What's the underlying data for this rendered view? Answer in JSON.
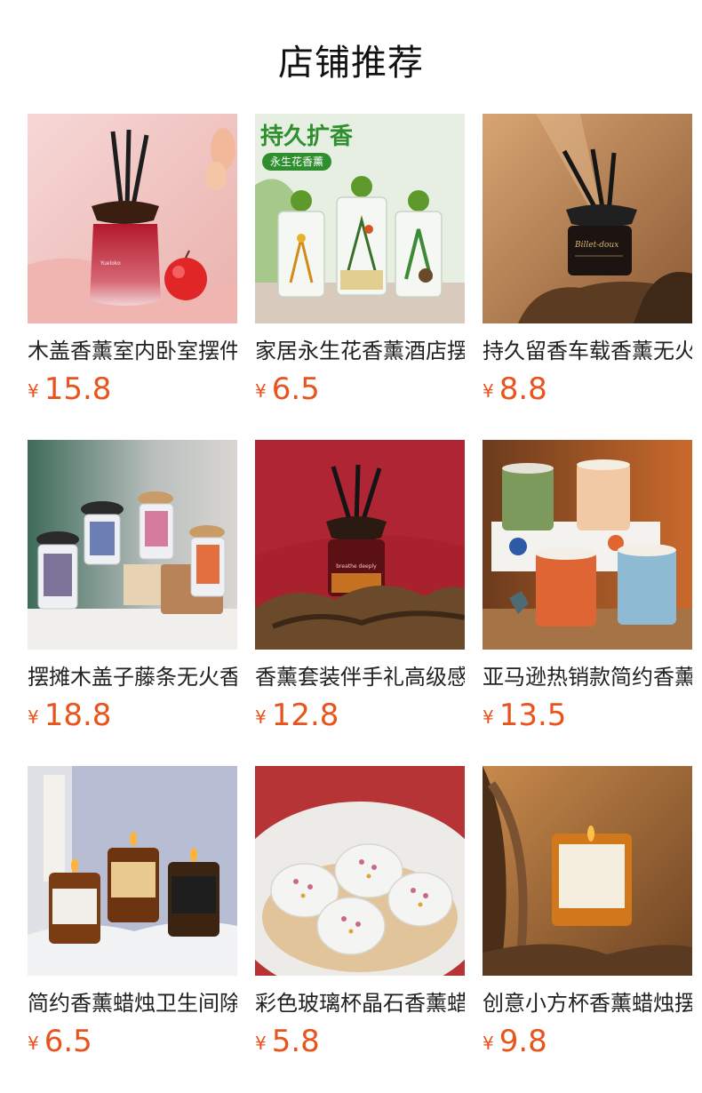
{
  "header": {
    "title": "店铺推荐"
  },
  "products": [
    {
      "name": "木盖香薰室内卧室摆件",
      "currency": "¥",
      "price": "15.8",
      "image": "red-diffuser-apple"
    },
    {
      "name": "家居永生花香薰酒店摆件",
      "currency": "¥",
      "price": "6.5",
      "image": "preserved-flower-diffusers",
      "image_text": {
        "headline": "持久扩香",
        "subline": "永生花香薰"
      }
    },
    {
      "name": "持久留香车载香薰无火",
      "currency": "¥",
      "price": "8.8",
      "image": "black-diffuser-driftwood"
    },
    {
      "name": "摆摊木盖子藤条无火香薰",
      "currency": "¥",
      "price": "18.8",
      "image": "illustrated-bottle-diffusers"
    },
    {
      "name": "香薰套装伴手礼高级感",
      "currency": "¥",
      "price": "12.8",
      "image": "dark-diffuser-red-backdrop"
    },
    {
      "name": "亚马逊热销款简约香薰蜡烛",
      "currency": "¥",
      "price": "13.5",
      "image": "colored-candle-jars"
    },
    {
      "name": "简约香薰蜡烛卫生间除味",
      "currency": "¥",
      "price": "6.5",
      "image": "amber-label-candles"
    },
    {
      "name": "彩色玻璃杯晶石香薰蜡烛",
      "currency": "¥",
      "price": "5.8",
      "image": "white-flower-candles"
    },
    {
      "name": "创意小方杯香薰蜡烛摆件",
      "currency": "¥",
      "price": "9.8",
      "image": "square-candle-sun-kissed"
    }
  ],
  "colors": {
    "price": "#e8541c",
    "title": "#111111",
    "text": "#222222"
  }
}
